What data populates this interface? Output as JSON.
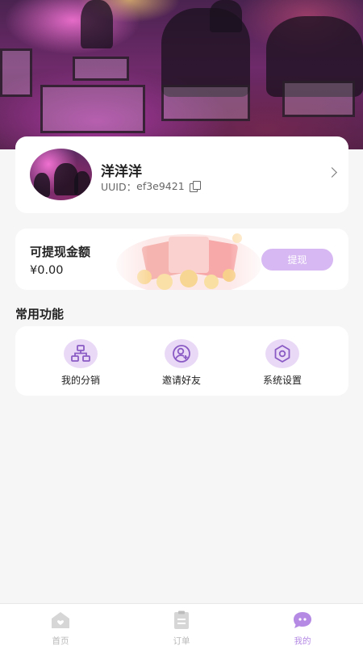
{
  "profile": {
    "name": "洋洋洋",
    "uuid_label": "UUID：",
    "uuid_value": "ef3e9421"
  },
  "balance": {
    "title": "可提现金额",
    "amount": "¥0.00",
    "withdraw_label": "提现"
  },
  "functions": {
    "section_title": "常用功能",
    "items": [
      {
        "label": "我的分销",
        "icon": "distribution-icon"
      },
      {
        "label": "邀请好友",
        "icon": "invite-friend-icon"
      },
      {
        "label": "系统设置",
        "icon": "settings-icon"
      }
    ]
  },
  "tabbar": {
    "items": [
      {
        "label": "首页",
        "icon": "home-icon",
        "active": false
      },
      {
        "label": "订单",
        "icon": "order-clipboard-icon",
        "active": false
      },
      {
        "label": "我的",
        "icon": "profile-chat-icon",
        "active": true
      }
    ]
  },
  "colors": {
    "accent": "#b48ae4",
    "button_bg": "#d7b8f2",
    "icon_bg": "#e9d9f6",
    "icon_stroke": "#8a5bc4"
  }
}
